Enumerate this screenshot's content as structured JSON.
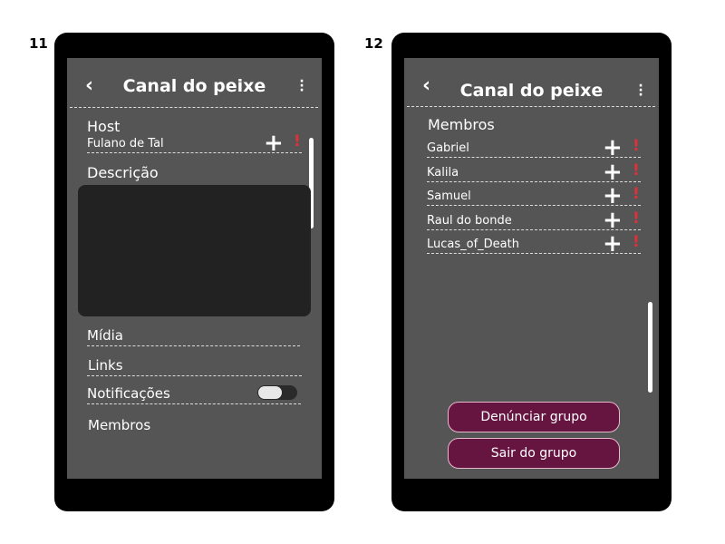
{
  "screens": [
    {
      "number": "11",
      "header": {
        "title": "Canal do peixe",
        "back": "‹",
        "menu": "⋮"
      },
      "host": {
        "label": "Host",
        "name": "Fulano de Tal"
      },
      "description_label": "Descrição",
      "media_label": "Mídia",
      "links_label": "Links",
      "notifications": {
        "label": "Notificações",
        "enabled": false
      },
      "members_label": "Membros"
    },
    {
      "number": "12",
      "header": {
        "title": "Canal do peixe",
        "back": "‹",
        "menu": "⋮"
      },
      "members_label": "Membros",
      "members": [
        "Gabriel",
        "Kalila",
        "Samuel",
        "Raul do bonde",
        "Lucas_of_Death"
      ],
      "buttons": {
        "report": "Denúnciar grupo",
        "leave": "Sair do grupo"
      }
    }
  ],
  "icons": {
    "plus": "+",
    "report": "!"
  },
  "colors": {
    "screen": "#555555",
    "button": "#661540",
    "alert": "#e0303a"
  }
}
